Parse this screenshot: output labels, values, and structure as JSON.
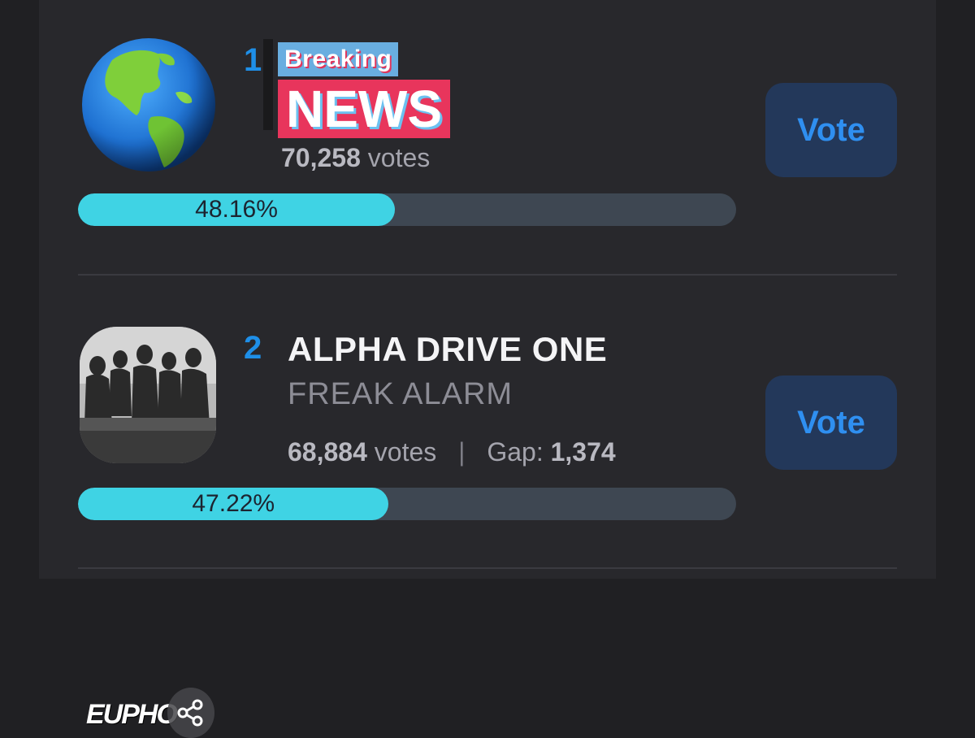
{
  "entries": [
    {
      "rank": "1",
      "logo_top": "Breaking",
      "logo_bottom": "NEWS",
      "votes_count": "70,258",
      "votes_unit": "votes",
      "percent_label": "48.16%",
      "percent": 48.16,
      "vote_label": "Vote"
    },
    {
      "rank": "2",
      "title": "ALPHA DRIVE ONE",
      "subtitle": "FREAK ALARM",
      "votes_count": "68,884",
      "votes_unit": "votes",
      "separator": "|",
      "gap_label": "Gap:",
      "gap_value": "1,374",
      "photo_text": "EUPHO",
      "percent_label": "47.22%",
      "percent": 47.22,
      "vote_label": "Vote"
    }
  ],
  "colors": {
    "accent": "#1e8fe8",
    "progress_fill": "#3fd3e4",
    "progress_track": "#3e4752",
    "vote_button_bg": "#23385a"
  },
  "icons": [
    "globe-icon",
    "share-icon"
  ]
}
